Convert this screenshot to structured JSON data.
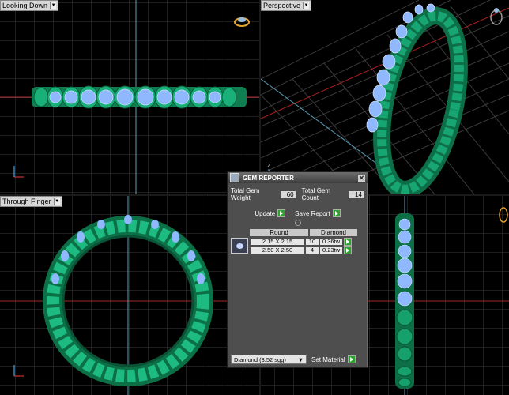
{
  "viewports": {
    "top_left": {
      "label": "Looking Down"
    },
    "top_right": {
      "label": "Perspective"
    },
    "bottom_left": {
      "label": "Through Finger"
    }
  },
  "axis": {
    "z_label": "Z"
  },
  "gem_reporter": {
    "title": "GEM REPORTER",
    "total_weight_label": "Total Gem Weight",
    "total_weight_value": "60",
    "total_count_label": "Total Gem Count",
    "total_count_value": "14",
    "update_label": "Update",
    "save_report_label": "Save Report",
    "table": {
      "shape_header": "Round",
      "type_header": "Diamond",
      "rows": [
        {
          "size": "2.15 X 2.15",
          "count": "10",
          "weight": "0.36tw"
        },
        {
          "size": "2.50 X 2.50",
          "count": "4",
          "weight": "0.23tw"
        }
      ]
    },
    "material_select": "Diamond    (3.52 sgg)",
    "set_material_label": "Set Material"
  },
  "colors": {
    "metal": "#14a06a",
    "gem": "#7fb0ff",
    "grid": "#3a3a3a",
    "axis_red": "#b22222",
    "axis_blue": "#5fa3c2"
  }
}
